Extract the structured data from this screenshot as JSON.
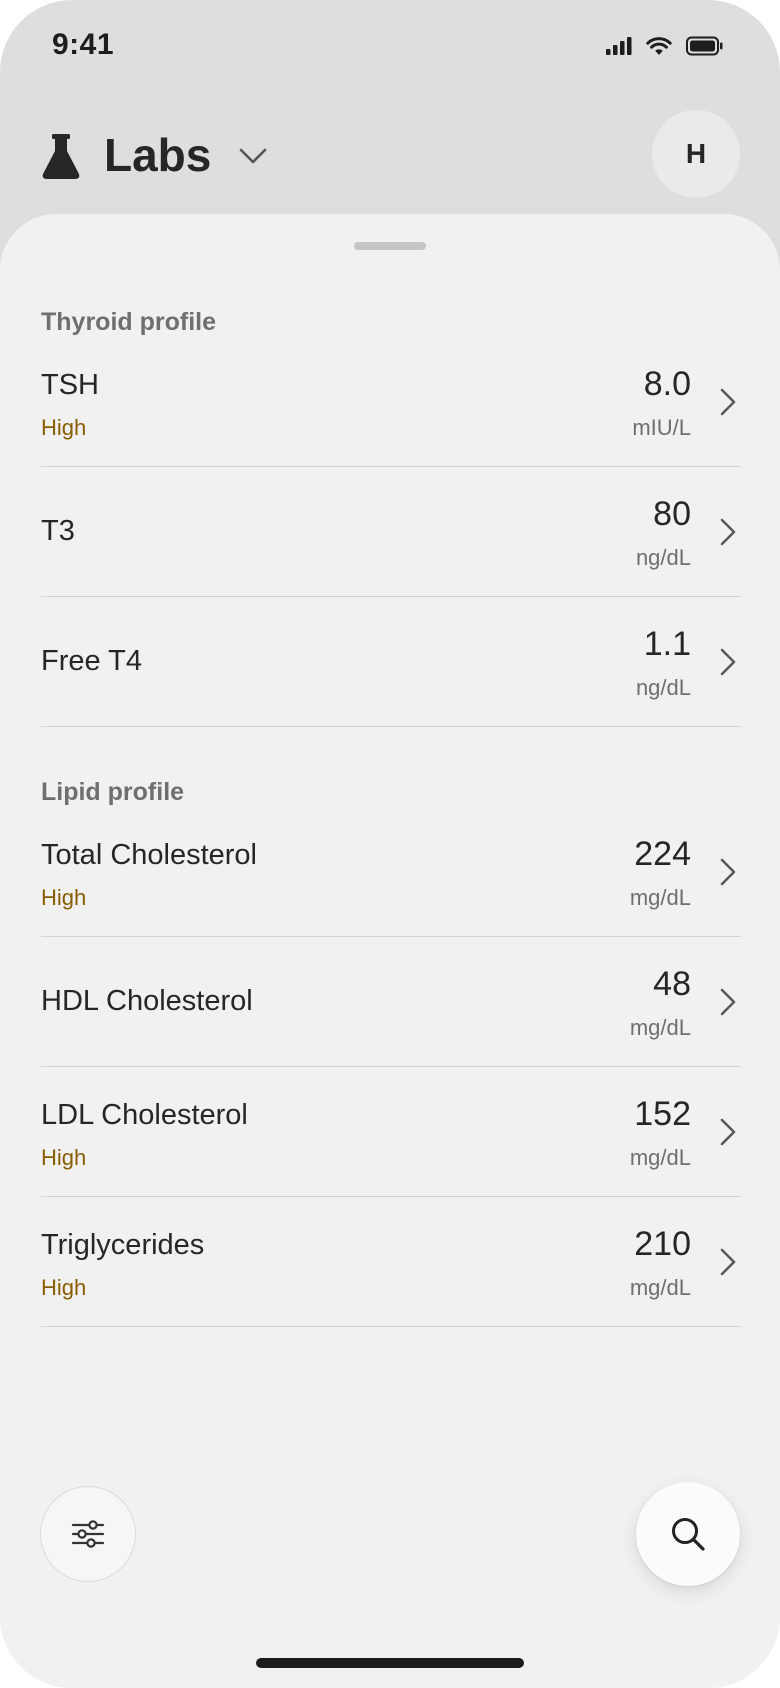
{
  "status_bar": {
    "time": "9:41"
  },
  "header": {
    "title": "Labs",
    "avatar_initial": "H"
  },
  "sections": [
    {
      "title": "Thyroid profile",
      "rows": [
        {
          "name": "TSH",
          "flag": "High",
          "value": "8.0",
          "unit": "mIU/L"
        },
        {
          "name": "T3",
          "flag": "",
          "value": "80",
          "unit": "ng/dL"
        },
        {
          "name": "Free T4",
          "flag": "",
          "value": "1.1",
          "unit": "ng/dL"
        }
      ]
    },
    {
      "title": "Lipid profile",
      "rows": [
        {
          "name": "Total Cholesterol",
          "flag": "High",
          "value": "224",
          "unit": "mg/dL"
        },
        {
          "name": "HDL Cholesterol",
          "flag": "",
          "value": "48",
          "unit": "mg/dL"
        },
        {
          "name": "LDL Cholesterol",
          "flag": "High",
          "value": "152",
          "unit": "mg/dL"
        },
        {
          "name": "Triglycerides",
          "flag": "High",
          "value": "210",
          "unit": "mg/dL"
        }
      ]
    }
  ],
  "icons": {
    "title_icon": "flask-icon",
    "title_dropdown": "chevron-down-icon",
    "row_chevron": "chevron-right-icon",
    "filter_button": "sliders-icon",
    "search_button": "search-icon",
    "status": [
      "cellular-signal-icon",
      "wifi-icon",
      "battery-icon"
    ]
  },
  "colors": {
    "flag_high": "#8a5c00",
    "sheet_background": "#f1f1f1",
    "header_background": "#dfdddd"
  }
}
